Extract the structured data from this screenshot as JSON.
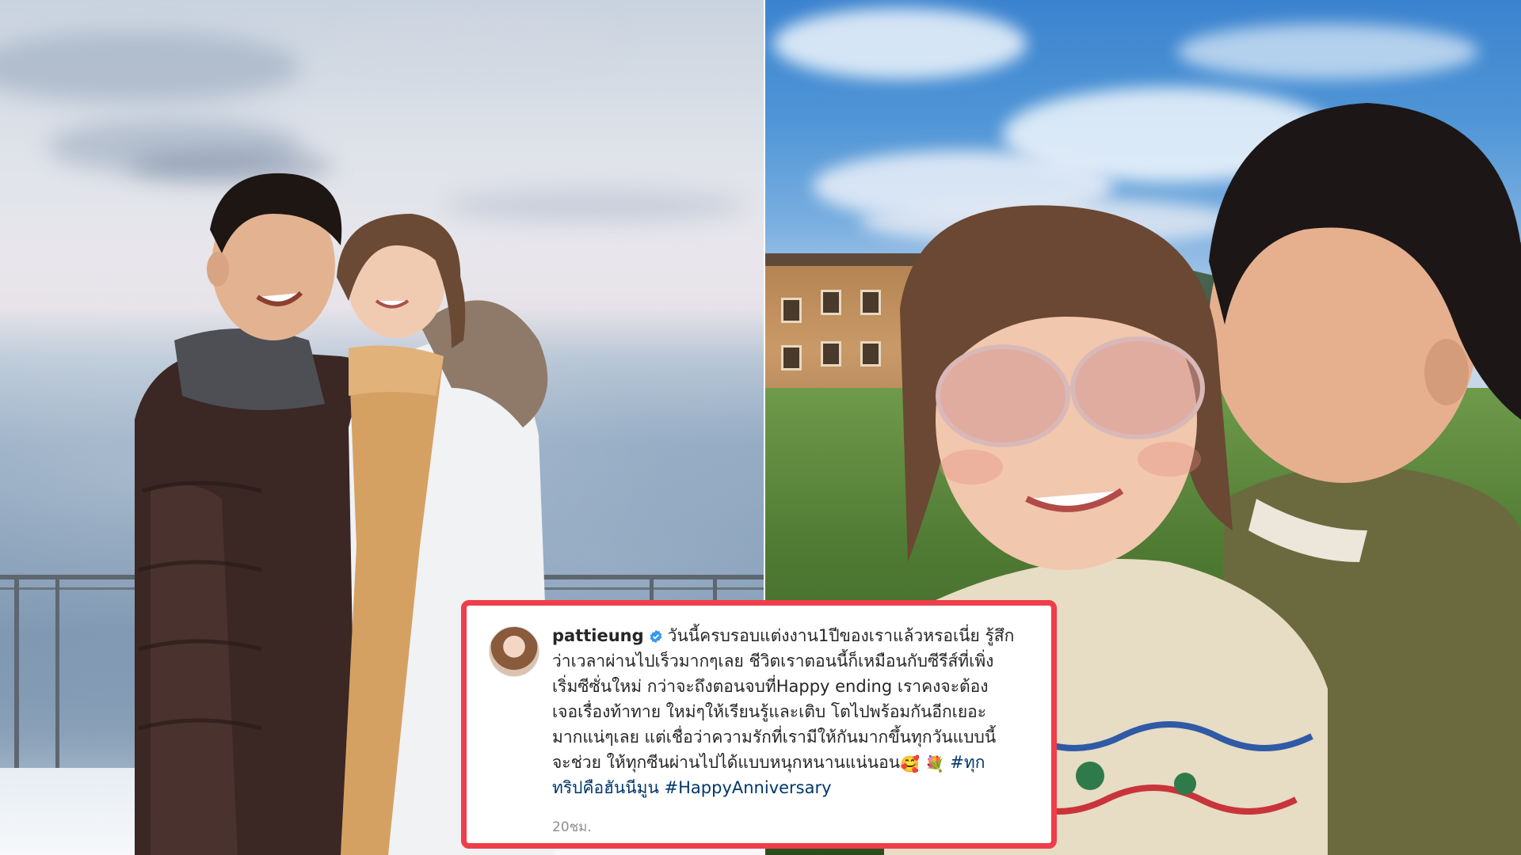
{
  "post": {
    "username": "pattieung",
    "caption_lines": [
      "วันนี้ครบรอบแต่งงาน1ปีของเราแล้วหรอเนี่ย รู้สึก",
      "ว่าเวลาผ่านไปเร็วมากๆเลย ชีวิตเราตอนนี้ก็เหมือนกับซีรีส์ที่เพิ่ง",
      "เริ่มซีซั่นใหม่ กว่าจะถึงตอนจบที่Happy ending เราคงจะต้อง",
      "เจอเรื่องท้าทาย ใหม่ๆให้เรียนรู้และเติบ โตไปพร้อมกันอีกเยอะ",
      "มากแน่ๆเลย แต่เชื่อว่าความรักที่เรามีให้กันมากขึ้นทุกวันแบบนี้",
      "จะช่วย ให้ทุกซีนผ่านไปได้แบบหนุกหนานแน่นอน"
    ],
    "emojis": [
      "🥰",
      "💐"
    ],
    "hashtag_1_part_a": "#ทุก",
    "hashtag_1_part_b": "ทริปคือฮันนีมูน",
    "hashtag_2": "#HappyAnniversary",
    "timestamp": "20ชม."
  },
  "icons": {
    "verified": "verified-badge-icon",
    "avatar": "profile-avatar"
  },
  "colors": {
    "card_border": "#ef3e4a",
    "hashtag": "#00376b",
    "verified": "#3897f0",
    "text": "#262626",
    "muted": "#8e8e8e"
  }
}
